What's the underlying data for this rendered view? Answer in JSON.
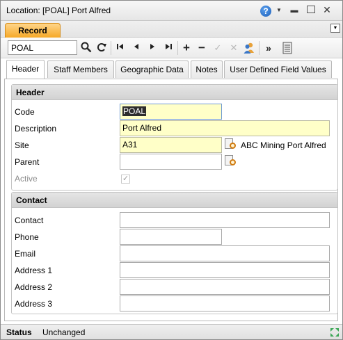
{
  "window": {
    "title": "Location: [POAL] Port Alfred"
  },
  "record_tab": {
    "label": "Record"
  },
  "toolbar": {
    "search_value": "POAL",
    "icons": [
      "search-icon",
      "refresh-icon",
      "first-record-icon",
      "previous-record-icon",
      "next-record-icon",
      "last-record-icon",
      "add-icon",
      "delete-icon",
      "save-icon",
      "cancel-icon",
      "users-icon",
      "expand-icon",
      "notes-icon"
    ]
  },
  "tabs": [
    {
      "label": "Header"
    },
    {
      "label": "Staff Members"
    },
    {
      "label": "Geographic Data"
    },
    {
      "label": "Notes"
    },
    {
      "label": "User Defined Field Values"
    }
  ],
  "header_group": {
    "title": "Header",
    "code_label": "Code",
    "code_value": "POAL",
    "description_label": "Description",
    "description_value": "Port Alfred",
    "site_label": "Site",
    "site_value": "A31",
    "site_description": "ABC Mining Port Alfred",
    "parent_label": "Parent",
    "parent_value": "",
    "active_label": "Active",
    "active_checked": true
  },
  "contact_group": {
    "title": "Contact",
    "contact_label": "Contact",
    "contact_value": "",
    "phone_label": "Phone",
    "phone_value": "",
    "email_label": "Email",
    "email_value": "",
    "address1_label": "Address 1",
    "address1_value": "",
    "address2_label": "Address 2",
    "address2_value": "",
    "address3_label": "Address 3",
    "address3_value": ""
  },
  "statusbar": {
    "label": "Status",
    "value": "Unchanged"
  },
  "colors": {
    "record_tab": "#f5a623",
    "required_field": "#ffffc8",
    "help_icon": "#1d5fb8"
  }
}
